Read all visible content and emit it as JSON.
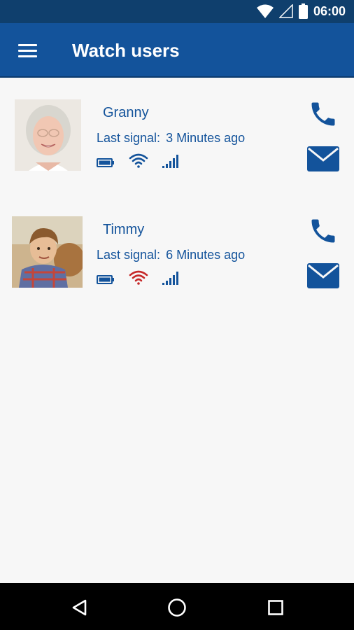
{
  "status_bar": {
    "time": "06:00",
    "icons": [
      "wifi-icon",
      "cell-signal-icon",
      "battery-icon"
    ]
  },
  "app_bar": {
    "title": "Watch users",
    "menu_icon": "hamburger-menu-icon"
  },
  "users": [
    {
      "name": "Granny",
      "last_signal_label": "Last signal:",
      "last_signal_value": "3 Minutes ago",
      "wifi_status_color": "#13539b",
      "icons": [
        "battery-icon",
        "wifi-icon",
        "signal-bars-icon",
        "phone-icon",
        "mail-icon"
      ]
    },
    {
      "name": "Timmy",
      "last_signal_label": "Last signal:",
      "last_signal_value": "6 Minutes ago",
      "wifi_status_color": "#c62828",
      "icons": [
        "battery-icon",
        "wifi-icon",
        "signal-bars-icon",
        "phone-icon",
        "mail-icon"
      ]
    }
  ],
  "nav_bar": {
    "icons": [
      "back-icon",
      "home-icon",
      "recents-icon"
    ]
  },
  "colors": {
    "primary": "#13539b",
    "status_bar": "#0f3f6d",
    "alert": "#c62828",
    "background": "#f7f7f7"
  }
}
